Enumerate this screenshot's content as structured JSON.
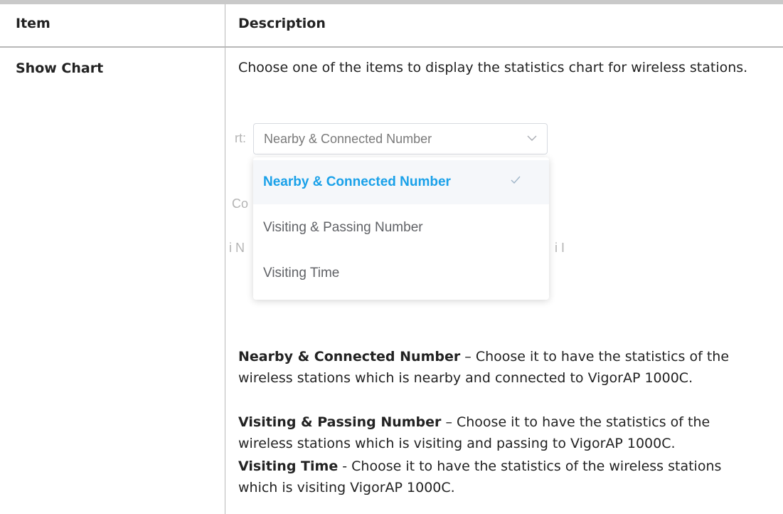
{
  "table": {
    "headers": {
      "item": "Item",
      "description": "Description"
    },
    "row": {
      "item": "Show Chart",
      "intro": "Choose one of the items to display the statistics chart for wireless stations.",
      "screenshot": {
        "ghost_label_1": "rt:",
        "ghost_label_2": "Co",
        "ghost_label_3": "i N",
        "ghost_label_4": "i I",
        "select_value": "Nearby & Connected Number",
        "options": [
          "Nearby & Connected Number",
          "Visiting & Passing Number",
          "Visiting Time"
        ],
        "selected_color": "#1aa1e9"
      },
      "items": [
        {
          "term": "Nearby & Connected Number",
          "text": " – Choose it to have the statistics of the wireless stations which is nearby and connected to VigorAP 1000C."
        },
        {
          "term": "Visiting & Passing Number",
          "text": " – Choose it to have the statistics of the wireless stations which is visiting and passing to VigorAP 1000C."
        },
        {
          "term": "Visiting Time",
          "text": " - Choose it to have the statistics of the wireless stations which is visiting VigorAP 1000C."
        }
      ]
    }
  }
}
